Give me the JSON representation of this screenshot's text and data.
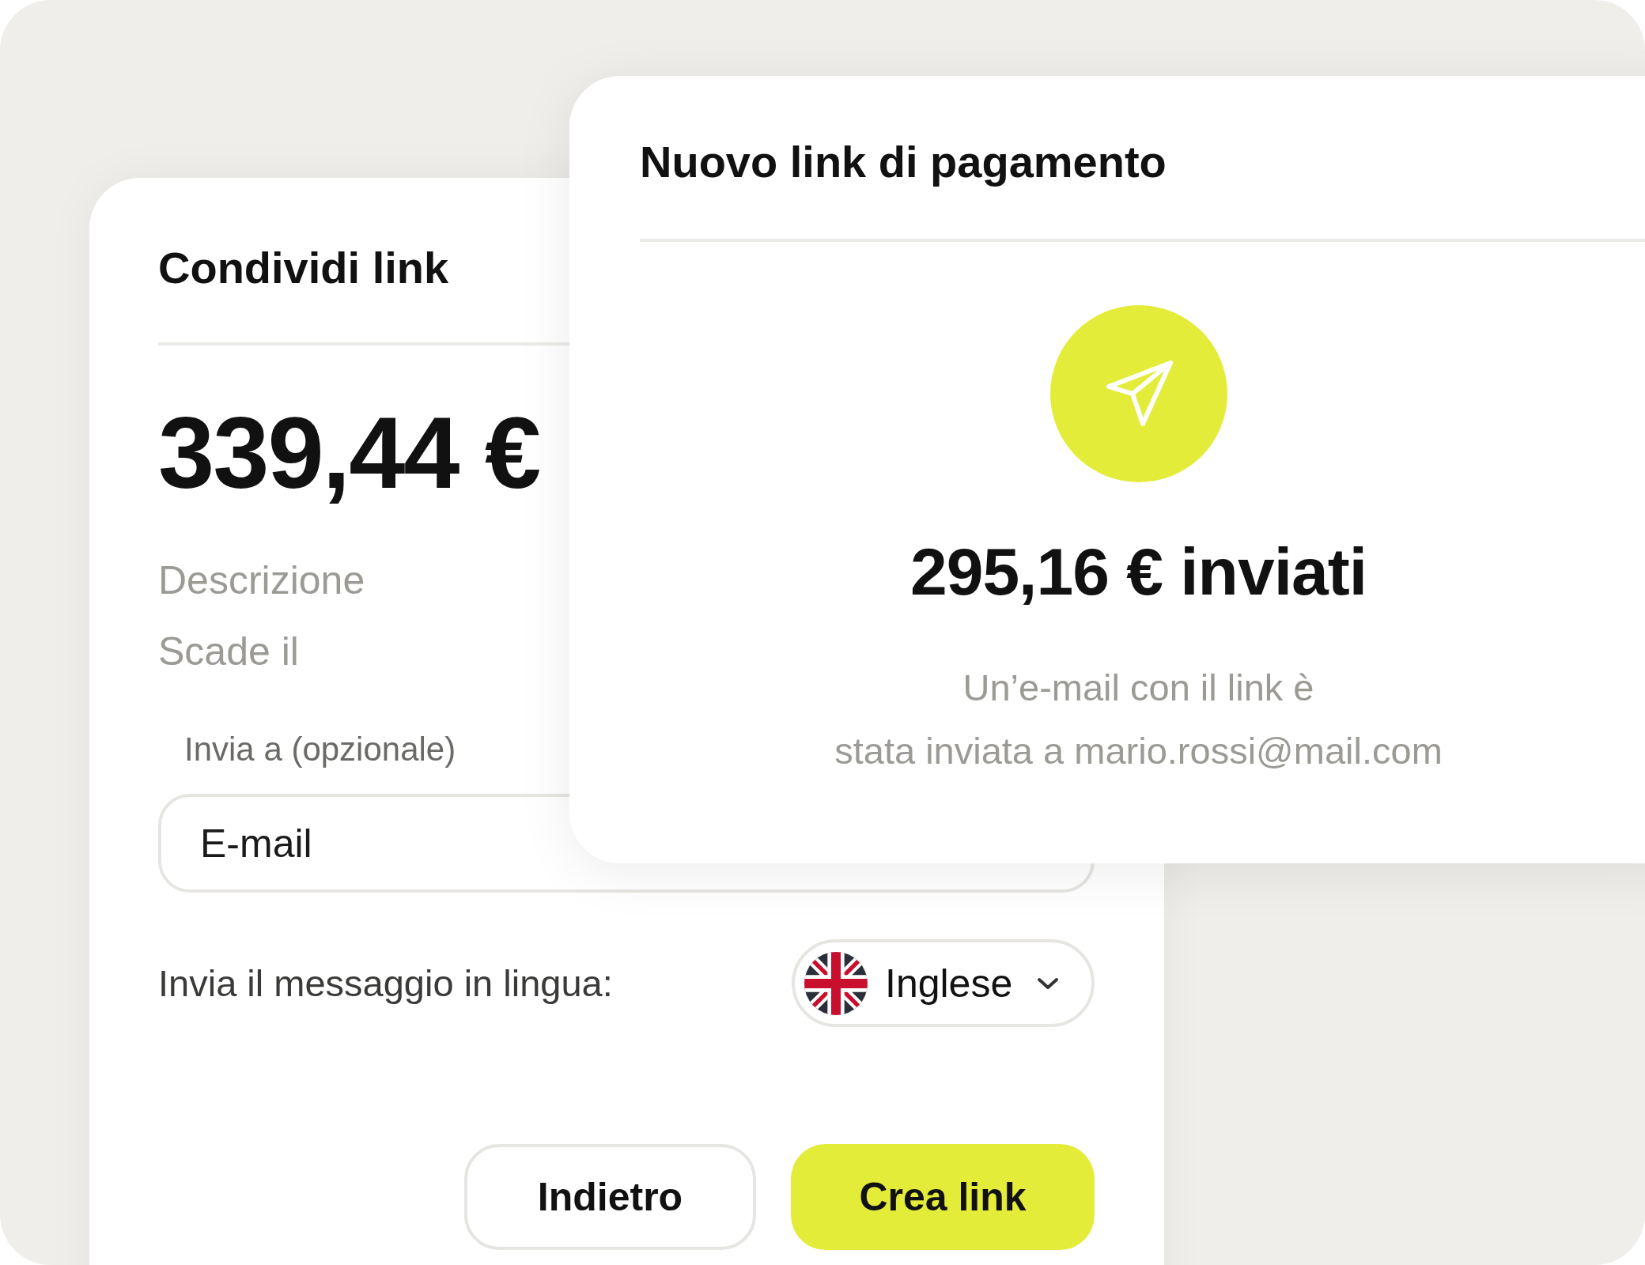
{
  "share_card": {
    "title": "Condividi link",
    "amount": "339,44 €",
    "fields": [
      {
        "label": "Descrizione"
      },
      {
        "label": "Scade il"
      }
    ],
    "send_to": {
      "label": "Invia a (opzionale)",
      "placeholder": "E-mail"
    },
    "language": {
      "label": "Invia il messaggio in lingua:",
      "value": "Inglese"
    },
    "buttons": [
      {
        "label": "Indietro",
        "kind": "secondary"
      },
      {
        "label": "Crea link",
        "kind": "primary"
      }
    ]
  },
  "success_card": {
    "title": "Nuovo link di pagamento",
    "amount": "295,16 € inviati",
    "message_lines": [
      "Un’e-mail con il link è",
      "stata inviata a mario.rossi@mail.com"
    ]
  }
}
